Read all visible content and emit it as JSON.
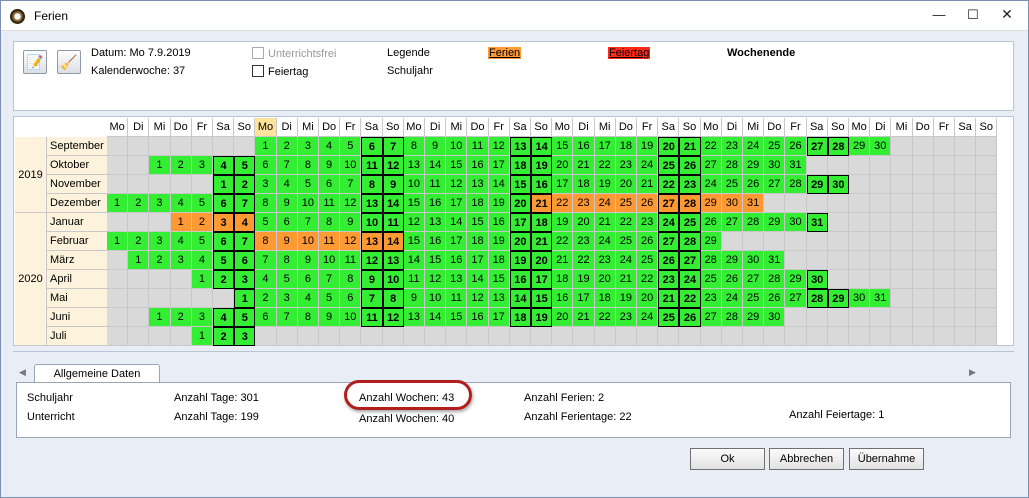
{
  "window": {
    "title": "Ferien",
    "min_glyph": "—",
    "max_glyph": "☐",
    "close_glyph": "✕"
  },
  "header": {
    "date_label": "Datum: Mo 7.9.2019",
    "week_label": "Kalenderwoche: 37",
    "unterrichtsfrei_label": "Unterrichtsfrei",
    "feiertag_label": "Feiertag",
    "legende_label": "Legende",
    "schuljahr_label": "Schuljahr",
    "legend_ferien": "Ferien",
    "legend_feiertag": "Feiertag",
    "legend_wochenende": "Wochenende",
    "icons": [
      "edit-notes-icon",
      "wizard-icon"
    ]
  },
  "calendar": {
    "day_headers": [
      "Mo",
      "Di",
      "Mi",
      "Do",
      "Fr",
      "Sa",
      "So",
      "Mo",
      "Di",
      "Mi",
      "Do",
      "Fr",
      "Sa",
      "So",
      "Mo",
      "Di",
      "Mi",
      "Do",
      "Fr",
      "Sa",
      "So",
      "Mo",
      "Di",
      "Mi",
      "Do",
      "Fr",
      "Sa",
      "So",
      "Mo",
      "Di",
      "Mi",
      "Do",
      "Fr",
      "Sa",
      "So",
      "Mo",
      "Di",
      "Mi",
      "Do",
      "Fr",
      "Sa",
      "So"
    ],
    "today_column": 7,
    "years": [
      {
        "label": "2019",
        "rows": 4
      },
      {
        "label": "2020",
        "rows": 7
      }
    ],
    "months": [
      {
        "name": "September",
        "offset": 7,
        "days": 30,
        "holidays": [],
        "feiertage": []
      },
      {
        "name": "Oktober",
        "offset": 2,
        "days": 31,
        "holidays": [],
        "feiertage": []
      },
      {
        "name": "November",
        "offset": 5,
        "days": 30,
        "holidays": [],
        "feiertage": []
      },
      {
        "name": "Dezember",
        "offset": 0,
        "days": 31,
        "holidays": [
          21,
          22,
          23,
          24,
          25,
          26,
          27,
          28,
          29,
          30,
          31
        ],
        "feiertage": []
      },
      {
        "name": "Januar",
        "offset": 3,
        "days": 31,
        "holidays": [
          1,
          2,
          3,
          4
        ],
        "feiertage": []
      },
      {
        "name": "Februar",
        "offset": 0,
        "days": 29,
        "holidays": [
          8,
          9,
          10,
          11,
          12,
          13,
          14
        ],
        "feiertage": []
      },
      {
        "name": "März",
        "offset": 1,
        "days": 31,
        "holidays": [],
        "feiertage": []
      },
      {
        "name": "April",
        "offset": 4,
        "days": 30,
        "holidays": [],
        "feiertage": []
      },
      {
        "name": "Mai",
        "offset": 6,
        "days": 31,
        "holidays": [],
        "feiertage": [
          1
        ]
      },
      {
        "name": "Juni",
        "offset": 2,
        "days": 30,
        "holidays": [],
        "feiertage": []
      },
      {
        "name": "Juli",
        "offset": 4,
        "days": 3,
        "holidays": [],
        "feiertage": []
      }
    ]
  },
  "tabs": {
    "active": "Allgemeine Daten",
    "left_arrow": "◀",
    "right_arrow": "▶"
  },
  "info": {
    "row1_label": "Schuljahr",
    "row1_tage": "Anzahl Tage: 301",
    "row1_wochen": "Anzahl Wochen: 43",
    "row1_ferien": "Anzahl Ferien: 2",
    "row2_label": "Unterricht",
    "row2_tage": "Anzahl Tage: 199",
    "row2_wochen": "Anzahl Wochen: 40",
    "row2_ferientage": "Anzahl Ferientage: 22",
    "row2_feiertage": "Anzahl Feiertage: 1"
  },
  "buttons": {
    "ok": "Ok",
    "cancel": "Abbrechen",
    "apply": "Übernahme"
  }
}
